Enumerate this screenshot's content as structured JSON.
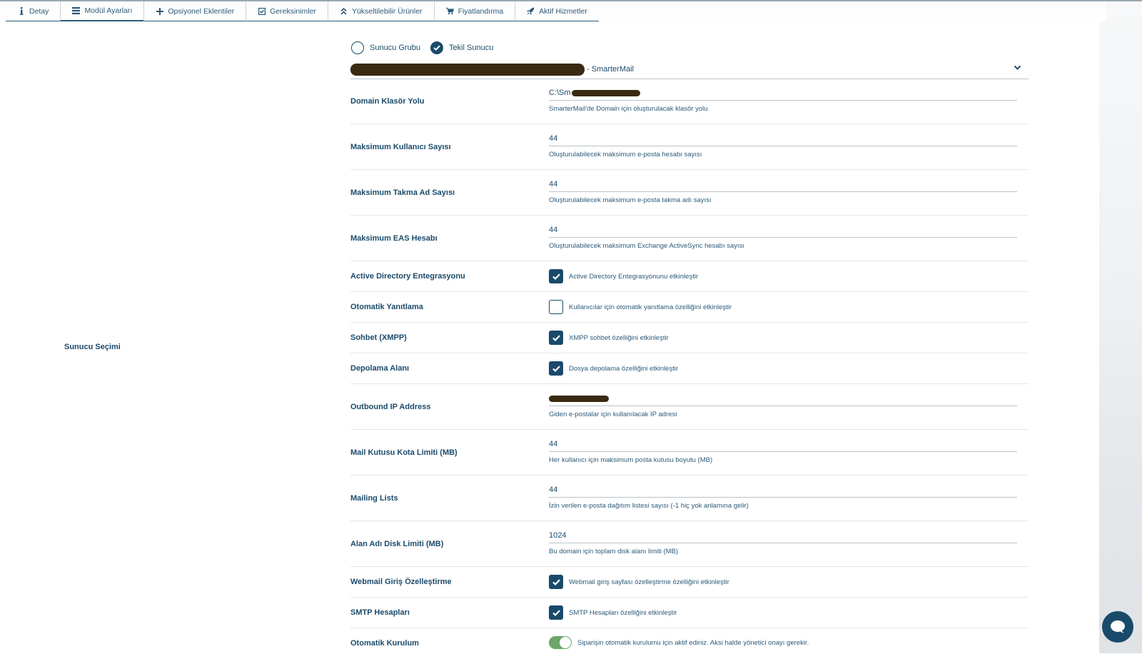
{
  "tabs": [
    {
      "label": "Detay",
      "icon": "info-icon"
    },
    {
      "label": "Modül Ayarları",
      "icon": "list-icon"
    },
    {
      "label": "Opsiyonel Eklentiler",
      "icon": "plus-icon"
    },
    {
      "label": "Gereksinimler",
      "icon": "check-square-icon"
    },
    {
      "label": "Yükseltilebilir Ürünler",
      "icon": "double-chevron-up-icon"
    },
    {
      "label": "Fiyatlandırma",
      "icon": "cart-icon"
    },
    {
      "label": "Aktif Hizmetler",
      "icon": "rocket-icon"
    }
  ],
  "active_tab": "Modül Ayarları",
  "left_section_label": "Sunucu Seçimi",
  "server_mode": {
    "options": [
      "Sunucu Grubu",
      "Tekil Sunucu"
    ],
    "selected": "Tekil Sunucu"
  },
  "server_select": {
    "suffix": "- SmarterMail"
  },
  "fields": {
    "domain_path": {
      "label": "Domain Klasör Yolu",
      "value": "C:\\Sm",
      "help": "SmarterMail'de Domain için oluşturulacak klasör yolu"
    },
    "max_users": {
      "label": "Maksimum Kullanıcı Sayısı",
      "value": "44",
      "help": "Oluşturulabilecek maksimum e-posta hesabı sayısı"
    },
    "max_alias": {
      "label": "Maksimum Takma Ad Sayısı",
      "value": "44",
      "help": "Oluşturulabilecek maksimum e-posta takma adı sayısı"
    },
    "max_eas": {
      "label": "Maksimum EAS Hesabı",
      "value": "44",
      "help": "Oluşturulabilecek maksimum Exchange ActiveSync hesabı sayısı"
    },
    "active_directory": {
      "label": "Active Directory Entegrasyonu",
      "text": "Active Directory Entegrasyonunu etkinleştir",
      "checked": true
    },
    "auto_reply": {
      "label": "Otomatik Yanıtlama",
      "text": "Kullanıcılar için otomatik yanıtlama özelliğini etkinleştir",
      "checked": false
    },
    "xmpp": {
      "label": "Sohbet (XMPP)",
      "text": "XMPP sohbet özelliğini etkinleştir",
      "checked": true
    },
    "storage": {
      "label": "Depolama Alanı",
      "text": "Dosya depolama özelliğini etkinleştir",
      "checked": true
    },
    "outbound_ip": {
      "label": "Outbound IP Address",
      "help": "Giden e-postalar için kullanılacak IP adresi"
    },
    "mailbox_quota": {
      "label": "Mail Kutusu Kota Limiti (MB)",
      "value": "44",
      "help": "Her kullanıcı için maksimum posta kutusu boyutu (MB)"
    },
    "mailing_lists": {
      "label": "Mailing Lists",
      "value": "44",
      "help": "İzin verilen e-posta dağıtım listesi sayısı (-1 hiç yok anlamına gelir)"
    },
    "disk_limit": {
      "label": "Alan Adı Disk Limiti (MB)",
      "value": "1024",
      "help": "Bu domain için toplam disk alanı limiti (MB)"
    },
    "webmail_custom": {
      "label": "Webmail Giriş Özelleştirme",
      "text": "Webmail giriş sayfası özelleştirme özelliğini etkinleştir",
      "checked": true
    },
    "smtp_accounts": {
      "label": "SMTP Hesapları",
      "text": "SMTP Hesapları özelliğini etkinleştir",
      "checked": true
    },
    "auto_setup": {
      "label": "Otomatik Kurulum",
      "text": "Siparişin otomatik kurulumu için aktif ediniz. Aksi halde yönetici onayı gerekir.",
      "enabled": true
    }
  },
  "colors": {
    "primary": "#1a4a6a",
    "toggle_on": "#6aa66a",
    "redaction": "#3a2a12"
  }
}
